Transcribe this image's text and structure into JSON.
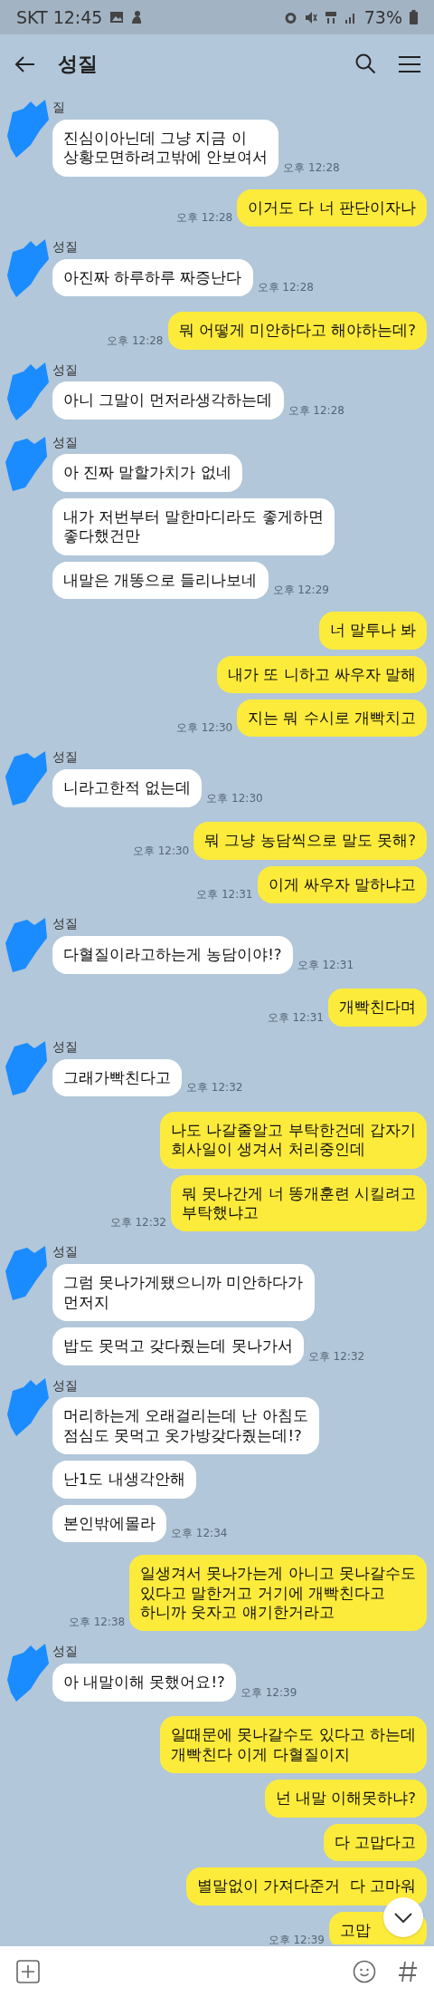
{
  "status_bar": {
    "carrier_time": "SKT 12:45",
    "battery": "73%"
  },
  "header": {
    "title": "성질"
  },
  "groups": [
    {
      "kind": "received",
      "name": "질",
      "messages": [
        {
          "text": "진심이아닌데 그냥 지금 이\n상황모면하려고밖에 안보여서",
          "time": "오후 12:28"
        }
      ]
    },
    {
      "kind": "sent",
      "messages": [
        {
          "text": "이거도 다 너 판단이자나",
          "time": "오후 12:28"
        }
      ]
    },
    {
      "kind": "received",
      "name": "성질",
      "messages": [
        {
          "text": "아진짜 하루하루 짜증난다",
          "time": "오후 12:28"
        }
      ]
    },
    {
      "kind": "sent",
      "messages": [
        {
          "text": "뭐 어떻게 미안하다고 해야하는데?",
          "time": "오후 12:28"
        }
      ]
    },
    {
      "kind": "received",
      "name": "성질",
      "messages": [
        {
          "text": "아니 그말이 먼저라생각하는데",
          "time": "오후 12:28"
        }
      ]
    },
    {
      "kind": "received",
      "name": "성질",
      "messages": [
        {
          "text": "아 진짜 말할가치가 없네"
        },
        {
          "text": "내가 저번부터 말한마디라도 좋게하면\n좋다했건만"
        },
        {
          "text": "내말은 개똥으로 들리나보네",
          "time": "오후 12:29"
        }
      ]
    },
    {
      "kind": "sent",
      "messages": [
        {
          "text": "너 말투나 봐"
        },
        {
          "text": "내가 또 니하고 싸우자 말해"
        },
        {
          "text": "지는 뭐 수시로 개빡치고",
          "time": "오후 12:30"
        }
      ]
    },
    {
      "kind": "received",
      "name": "성질",
      "messages": [
        {
          "text": "니라고한적 없는데",
          "time": "오후 12:30"
        }
      ]
    },
    {
      "kind": "sent",
      "messages": [
        {
          "text": "뭐 그냥 농담씩으로 말도 못해?",
          "time": "오후 12:30"
        },
        {
          "text": "이게 싸우자 말하냐고",
          "time": "오후 12:31"
        }
      ]
    },
    {
      "kind": "received",
      "name": "성질",
      "messages": [
        {
          "text": "다혈질이라고하는게 농담이야!?",
          "time": "오후 12:31"
        }
      ]
    },
    {
      "kind": "sent",
      "messages": [
        {
          "text": "개빡친다며",
          "time": "오후 12:31"
        }
      ]
    },
    {
      "kind": "received",
      "name": "성질",
      "messages": [
        {
          "text": "그래가빡친다고",
          "time": "오후 12:32"
        }
      ]
    },
    {
      "kind": "sent",
      "messages": [
        {
          "text": "나도 나갈줄알고 부탁한건데 갑자기\n회사일이 생겨서 처리중인데"
        },
        {
          "text": "뭐 못나간게 너 똥개훈련 시킬려고\n부탁했냐고",
          "time": "오후 12:32"
        }
      ]
    },
    {
      "kind": "received",
      "name": "성질",
      "messages": [
        {
          "text": "그럼 못나가게됐으니까 미안하다가\n먼저지"
        },
        {
          "text": "밥도 못먹고 갖다줬는데 못나가서",
          "time": "오후 12:32"
        }
      ]
    },
    {
      "kind": "received",
      "name": "성질",
      "messages": [
        {
          "text": "머리하는게 오래걸리는데 난 아침도\n점심도 못먹고 옷가방갖다줬는데!?"
        },
        {
          "text": "난1도 내생각안해"
        },
        {
          "text": "본인밖에몰라",
          "time": "오후 12:34"
        }
      ]
    },
    {
      "kind": "sent",
      "messages": [
        {
          "text": "일생겨서 못나가는게 아니고 못나갈수도\n있다고 말한거고 거기에 개빡친다고\n하니까 웃자고 얘기한거라고",
          "time": "오후 12:38"
        }
      ]
    },
    {
      "kind": "received",
      "name": "성질",
      "messages": [
        {
          "text": "아 내말이해 못했어요!?",
          "time": "오후 12:39"
        }
      ]
    },
    {
      "kind": "sent",
      "messages": [
        {
          "text": "일때문에 못나갈수도 있다고 하는데\n개빡친다 이게 다혈질이지"
        },
        {
          "text": "넌 내말 이해못하냐?"
        },
        {
          "text": "다 고맙다고"
        },
        {
          "text": "별말없이 가져다준거  다 고마워"
        },
        {
          "text": "고맙",
          "time": "오후 12:39",
          "covered": true
        }
      ]
    }
  ]
}
